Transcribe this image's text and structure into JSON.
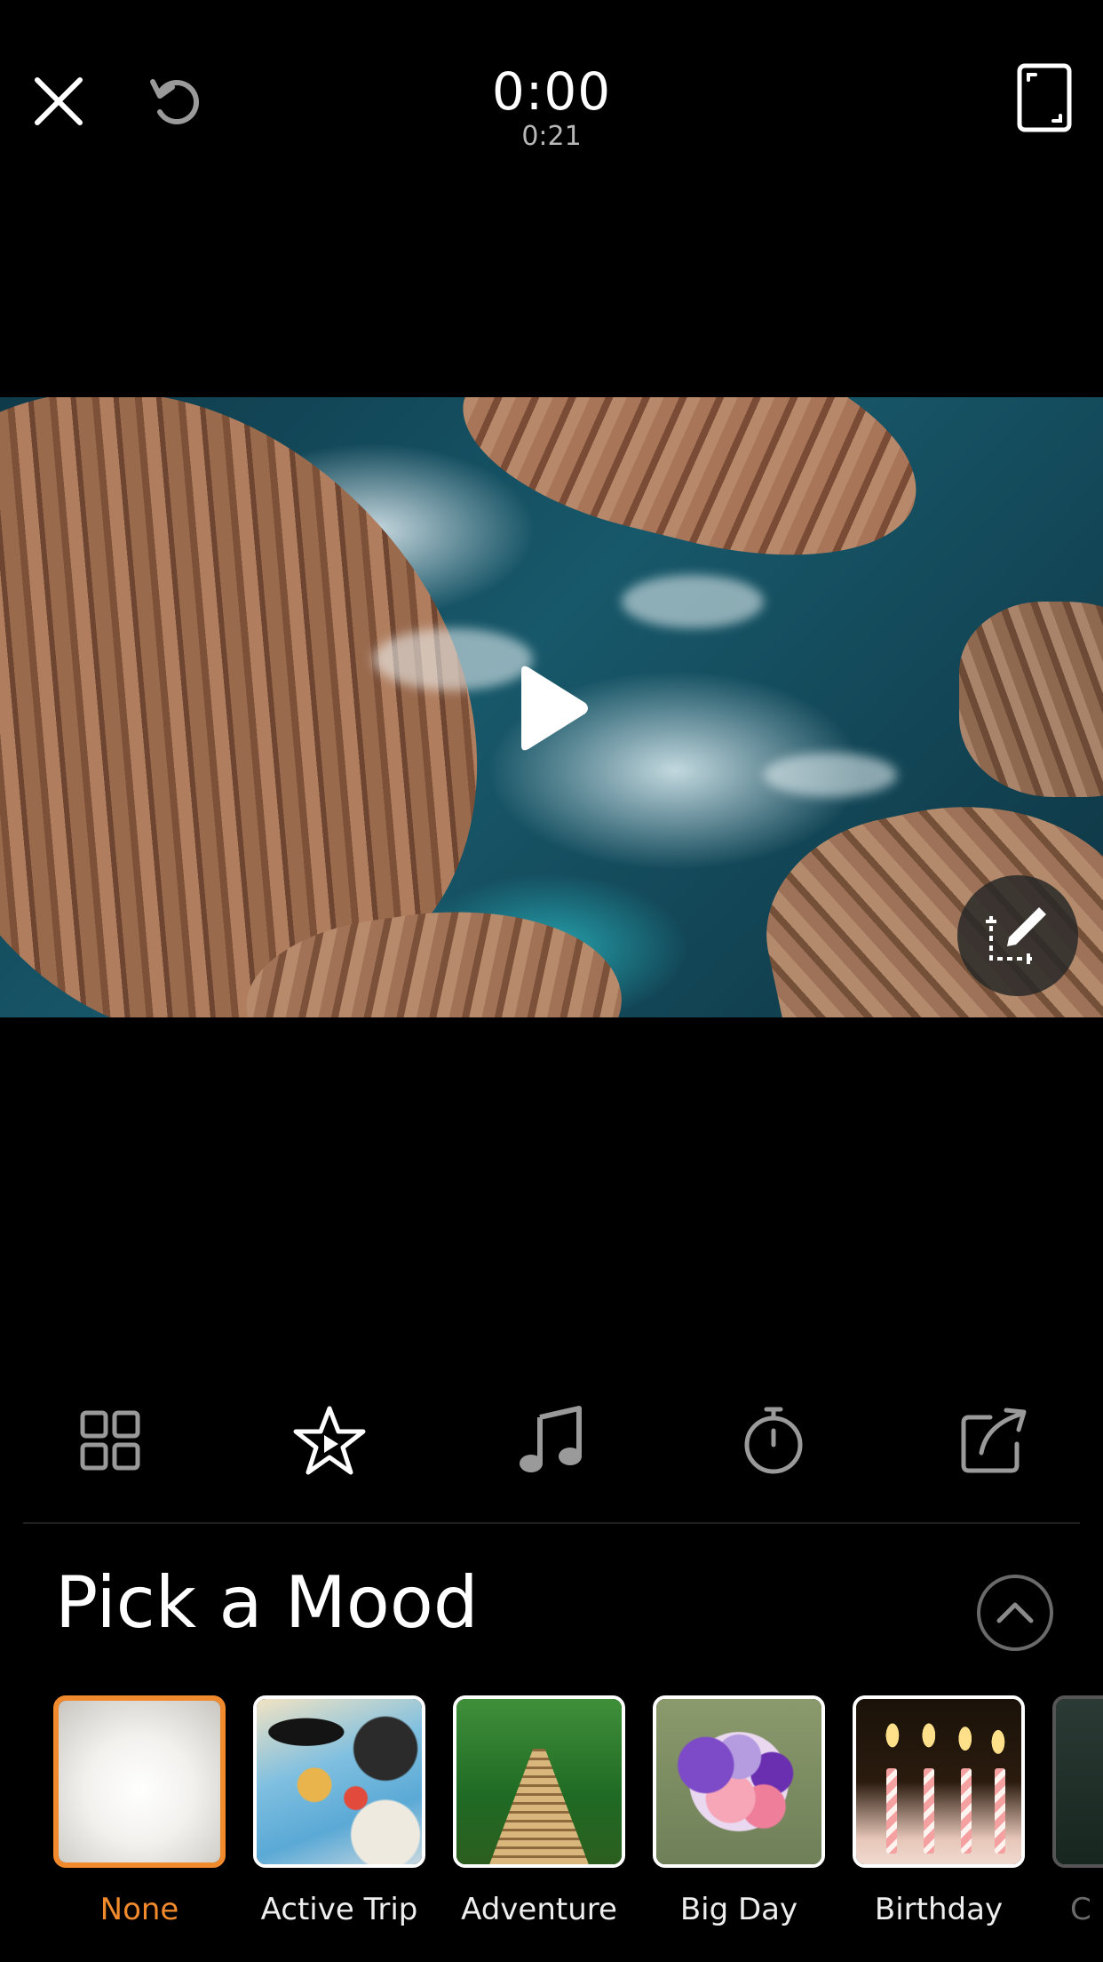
{
  "top_bar": {
    "current_time": "0:00",
    "total_time": "0:21",
    "icons": {
      "close": "close-icon",
      "undo": "undo-icon",
      "aspect": "aspect-ratio-icon"
    }
  },
  "video": {
    "icons": {
      "play": "play-icon",
      "crop": "crop-edit-icon"
    }
  },
  "tabs": [
    {
      "id": "layout",
      "icon": "grid-icon",
      "active": false
    },
    {
      "id": "mood",
      "icon": "star-icon",
      "active": true
    },
    {
      "id": "music",
      "icon": "music-note-icon",
      "active": false
    },
    {
      "id": "duration",
      "icon": "stopwatch-icon",
      "active": false
    },
    {
      "id": "share",
      "icon": "share-icon",
      "active": false
    }
  ],
  "mood_panel": {
    "title": "Pick a Mood",
    "moods": [
      {
        "label": "None",
        "selected": true
      },
      {
        "label": "Active Trip",
        "selected": false
      },
      {
        "label": "Adventure",
        "selected": false
      },
      {
        "label": "Big Day",
        "selected": false
      },
      {
        "label": "Birthday",
        "selected": false
      },
      {
        "label": "C",
        "selected": false
      }
    ]
  },
  "colors": {
    "accent": "#f08a2c",
    "background": "#000000",
    "inactive_icon": "#9a9a9a"
  }
}
